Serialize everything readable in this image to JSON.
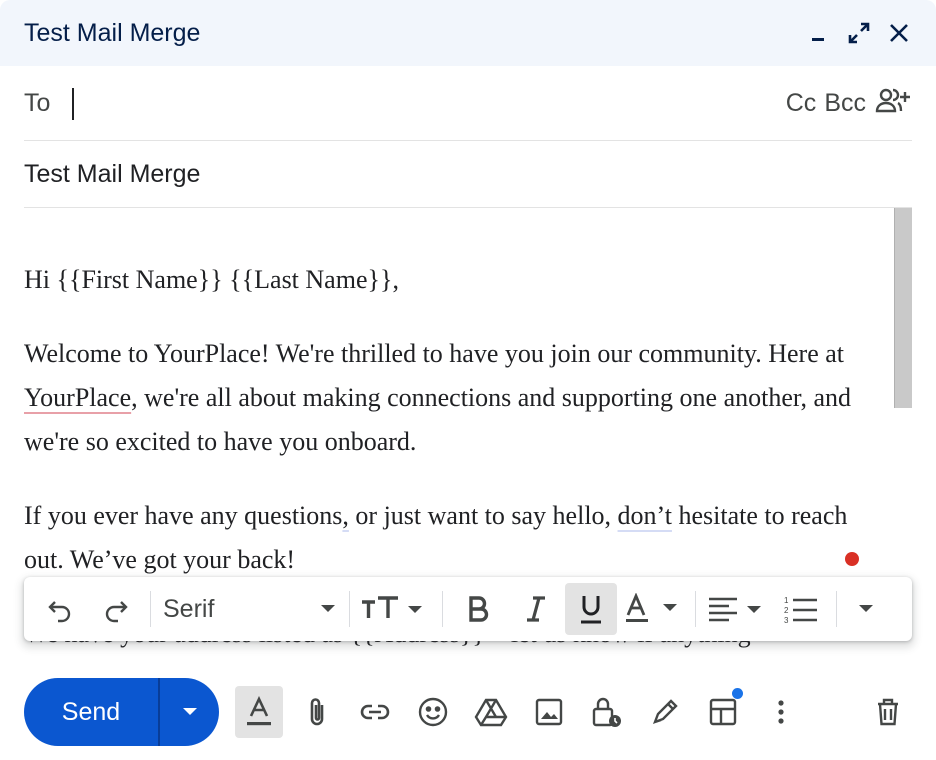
{
  "window": {
    "title": "Test Mail Merge"
  },
  "recipients": {
    "to_label": "To",
    "to_value": "",
    "cc_label": "Cc",
    "bcc_label": "Bcc"
  },
  "subject": "Test Mail Merge",
  "body": {
    "greeting": "Hi {{First Name}} {{Last Name}},",
    "p1_before": "Welcome to YourPlace! We're thrilled to have you join our community. Here at ",
    "p1_flag": "YourPlace",
    "p1_after": ", we're all about making connections and supporting one another, and we're so excited to have you onboard.",
    "p2_before": "If you ever have any questions",
    "p2_comma": ",",
    "p2_mid": " or just want to say hello, ",
    "p2_flag": "don’t",
    "p2_after": " hesitate to reach out. We’ve got your back!",
    "p3": "We have your address listed as {{Address}}—let us know if anything"
  },
  "format_toolbar": {
    "font": "Serif"
  },
  "send": {
    "label": "Send"
  },
  "colors": {
    "accent": "#0b57d0",
    "title_bg": "#f2f6fc",
    "red_dot": "#d93025",
    "blue_dot": "#1a73e8"
  }
}
